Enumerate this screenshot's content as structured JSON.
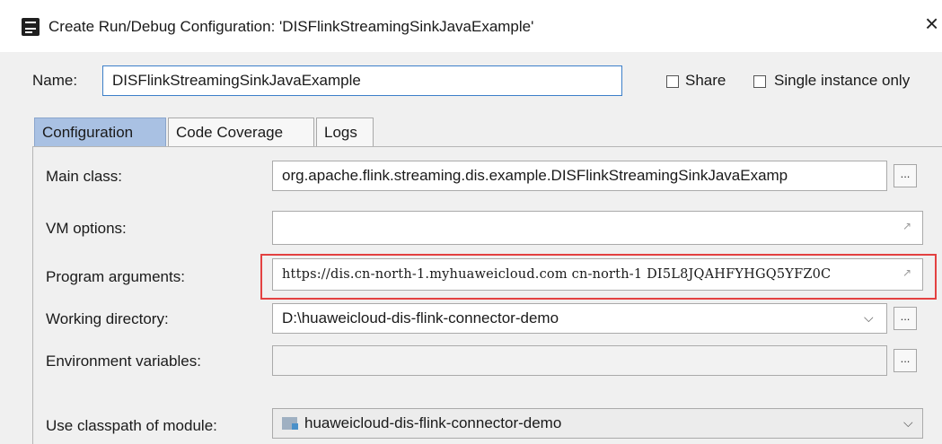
{
  "window": {
    "title": "Create Run/Debug Configuration: 'DISFlinkStreamingSinkJavaExample'"
  },
  "name_row": {
    "label": "Name:",
    "value": "DISFlinkStreamingSinkJavaExample",
    "share_label": "Share",
    "single_instance_label": "Single instance only",
    "share_checked": false,
    "single_instance_checked": false
  },
  "tabs": [
    {
      "label": "Configuration",
      "active": true
    },
    {
      "label": "Code Coverage",
      "active": false
    },
    {
      "label": "Logs",
      "active": false
    }
  ],
  "config": {
    "main_class_label": "Main class:",
    "main_class_value": "org.apache.flink.streaming.dis.example.DISFlinkStreamingSinkJavaExamp",
    "vm_options_label": "VM options:",
    "vm_options_value": "",
    "program_args_label": "Program arguments:",
    "program_args_value": "https://dis.cn-north-1.myhuaweicloud.com cn-north-1 DI5L8JQAHFYHGQ5YFZ0C",
    "working_dir_label": "Working directory:",
    "working_dir_value": "D:\\huaweicloud-dis-flink-connector-demo",
    "env_vars_label": "Environment variables:",
    "env_vars_value": "",
    "classpath_label": "Use classpath of module:",
    "classpath_value": "huaweicloud-dis-flink-connector-demo",
    "browse_label": "...",
    "expand_icon": "↗",
    "dropdown_icon": "⌵"
  },
  "colors": {
    "active_tab": "#a9c1e3",
    "highlight": "#e34141",
    "name_border": "#3c7fc9"
  }
}
